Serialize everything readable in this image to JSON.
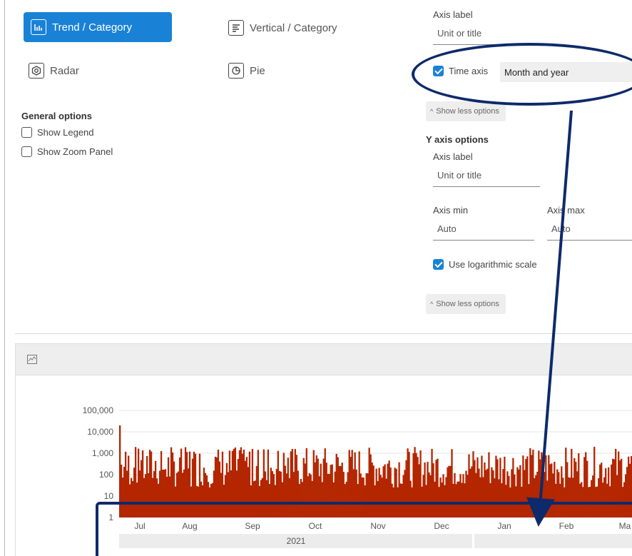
{
  "chart_types": {
    "trend": "Trend / Category",
    "vertical": "Vertical / Category",
    "radar": "Radar",
    "pie": "Pie"
  },
  "general_options": {
    "title": "General options",
    "show_legend": "Show Legend",
    "show_zoom": "Show Zoom Panel"
  },
  "x_axis": {
    "axis_label": "Axis label",
    "axis_label_placeholder": "Unit or title",
    "time_axis_label": "Time axis",
    "time_axis_value": "Month and year",
    "show_less": "Show less options"
  },
  "y_axis": {
    "title": "Y axis options",
    "axis_label": "Axis label",
    "axis_label_placeholder": "Unit or title",
    "axis_min_label": "Axis min",
    "axis_min_value": "Auto",
    "axis_max_label": "Axis max",
    "axis_max_value": "Auto",
    "log_scale_label": "Use logarithmic scale",
    "show_less": "Show less options"
  },
  "colors": {
    "accent": "#1a82d6",
    "bar": "#b32600",
    "annotation": "#0e2a6b"
  },
  "chart_data": {
    "type": "bar",
    "y_scale": "log",
    "ylim": [
      1,
      100000
    ],
    "y_ticks": [
      "100,000",
      "10,000",
      "1,000",
      "100",
      "10",
      "1"
    ],
    "x_ticks": [
      "Jul",
      "Aug",
      "Sep",
      "Oct",
      "Nov",
      "Dec",
      "Jan",
      "Feb",
      "Ma"
    ],
    "x_group_labels": [
      "2021"
    ],
    "series_color": "#b32600",
    "values_note": "dense daily counts, mostly between ~30 and ~2,000, peak ~20,000 at start of Jul"
  }
}
